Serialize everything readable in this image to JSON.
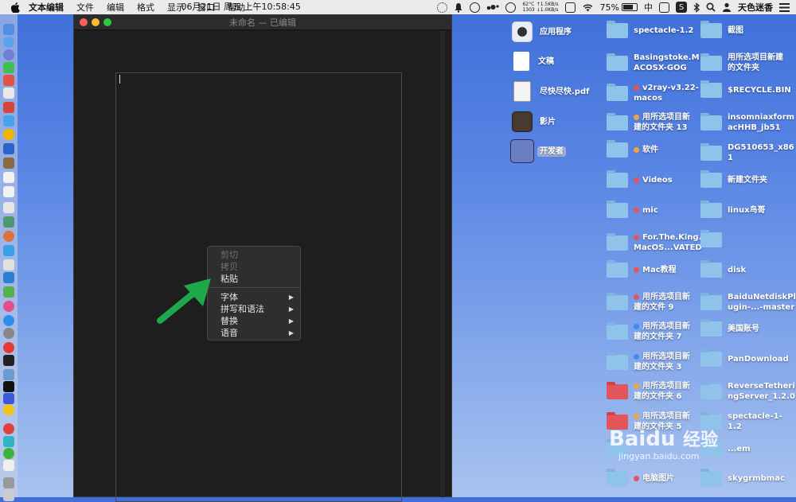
{
  "menubar": {
    "app_name": "文本编辑",
    "menus": [
      "文件",
      "编辑",
      "格式",
      "显示",
      "窗口",
      "帮助"
    ],
    "status": {
      "temp": "62°C",
      "net_up": "↑1.5KB/s",
      "rpm": "1303",
      "net_down": "↓1.0KB/s",
      "datetime": "06月21日 周五 上午10:58:45",
      "battery": "75%",
      "battery_level": 0.75,
      "input_method": "中",
      "user": "天色迷香"
    }
  },
  "window": {
    "title": "未命名 — 已编辑"
  },
  "context_menu": {
    "items": [
      {
        "label": "剪切",
        "enabled": false
      },
      {
        "label": "拷贝",
        "enabled": false
      },
      {
        "label": "粘贴",
        "enabled": true
      }
    ],
    "submenus": [
      {
        "label": "字体",
        "arrow": "▶"
      },
      {
        "label": "拼写和语法",
        "arrow": "▶"
      },
      {
        "label": "替换",
        "arrow": "▶"
      },
      {
        "label": "语音",
        "arrow": "▶"
      }
    ]
  },
  "desktop": {
    "col1": [
      {
        "label": "应用程序",
        "icon": "applications-icon"
      },
      {
        "label": "文稿",
        "icon": "document-icon"
      },
      {
        "label": "尽快尽快.pdf",
        "icon": "pdf-icon"
      },
      {
        "label": "影片",
        "icon": "movies-icon"
      },
      {
        "label": "开发者",
        "icon": "developer-icon"
      }
    ],
    "col2": [
      {
        "line1": "spectacle-1.2",
        "line2": "",
        "tag": ""
      },
      {
        "line1": "Basingstoke.M",
        "line2": "ACOSX-GOG",
        "tag": ""
      },
      {
        "line1": "v2ray-v3.22-",
        "line2": "macos",
        "tag": "red"
      },
      {
        "line1": "用所选项目新",
        "line2": "建的文件夹 13",
        "tag": "orange"
      },
      {
        "line1": "软件",
        "line2": "",
        "tag": "orange"
      },
      {
        "line1": "Videos",
        "line2": "",
        "tag": "red"
      },
      {
        "line1": "mic",
        "line2": "",
        "tag": "red"
      },
      {
        "line1": "For.The.King.",
        "line2": "MacOS...VATED",
        "tag": "red"
      },
      {
        "line1": "Mac教程",
        "line2": "",
        "tag": "red"
      },
      {
        "line1": "用所选项目新",
        "line2": "建的文件 9",
        "tag": "red"
      },
      {
        "line1": "用所选项目新",
        "line2": "建的文件夹 7",
        "tag": "blue"
      },
      {
        "line1": "用所选项目新",
        "line2": "建的文件夹 3",
        "tag": "blue"
      },
      {
        "line1": "用所选项目新",
        "line2": "建的文件夹 6",
        "tag": "orange"
      },
      {
        "line1": "用所选项目新",
        "line2": "建的文件夹 5",
        "tag": "orange"
      },
      {
        "line1": "",
        "line2": "",
        "tag": ""
      },
      {
        "line1": "电脑图片",
        "line2": "",
        "tag": "red"
      }
    ],
    "col3": [
      {
        "line1": "截图",
        "line2": ""
      },
      {
        "line1": "用所选项目新建",
        "line2": "的文件夹"
      },
      {
        "line1": "$RECYCLE.BIN",
        "line2": ""
      },
      {
        "line1": "insomniaxform",
        "line2": "acHHB_jb51"
      },
      {
        "line1": "DG510653_x86",
        "line2": "1"
      },
      {
        "line1": "新建文件夹",
        "line2": ""
      },
      {
        "line1": "linux鸟哥",
        "line2": ""
      },
      {
        "line1": "",
        "line2": ""
      },
      {
        "line1": "disk",
        "line2": ""
      },
      {
        "line1": "BaiduNetdiskPl",
        "line2": "ugin-...-master"
      },
      {
        "line1": "美国账号",
        "line2": ""
      },
      {
        "line1": "PanDownload",
        "line2": ""
      },
      {
        "line1": "ReverseTetheri",
        "line2": "ngServer_1.2.0"
      },
      {
        "line1": "spectacle-1-1.2",
        "line2": ""
      },
      {
        "line1": "...em",
        "line2": ""
      },
      {
        "line1": "skygrmbmac",
        "line2": ""
      }
    ]
  },
  "watermark": {
    "brand": "Baidu",
    "cn": "经验",
    "url": "jingyan.baidu.com"
  },
  "colors": {
    "tag_red": "#e3555a",
    "tag_orange": "#f2a33c",
    "tag_blue": "#3c8df2",
    "arrow_green": "#1ea84b"
  }
}
